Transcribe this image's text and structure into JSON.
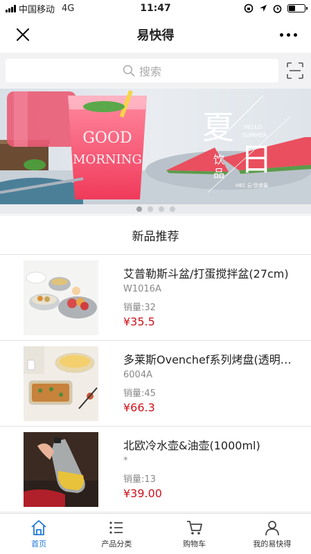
{
  "status_bar": {
    "carrier": "中国移动",
    "network": "4G",
    "time": "11:47"
  },
  "nav": {
    "title": "易快得",
    "close_icon": "close-icon",
    "more_icon": "more-icon"
  },
  "search": {
    "placeholder": "搜索",
    "scan_icon": "scan-icon"
  },
  "banner": {
    "glass_text_1": "GOOD",
    "glass_text_2": "MORNING",
    "big_char_1": "夏",
    "big_char_2": "日",
    "small_char_1": "饮",
    "small_char_2": "品",
    "hello": "HELLO",
    "summer": "SUMMER",
    "footer": "HEC 云·饮食篇",
    "slide_count": 4,
    "active_slide": 1
  },
  "section": {
    "title": "新品推荐"
  },
  "products": [
    {
      "name": "艾普勒斯斗盆/打蛋搅拌盆(27cm)",
      "code": "W1016A",
      "sales": "销量:32",
      "price": "¥35.5"
    },
    {
      "name": "多莱斯Ovenchef系列烤盘(透明…",
      "code": "6004A",
      "sales": "销量:45",
      "price": "¥66.3"
    },
    {
      "name": "北欧冷水壶&油壶(1000ml)",
      "code": "*",
      "sales": "销量:13",
      "price": "¥39.00"
    }
  ],
  "tabs": [
    {
      "label": "首页",
      "icon": "home-icon",
      "active": true
    },
    {
      "label": "产品分类",
      "icon": "list-icon",
      "active": false
    },
    {
      "label": "购物车",
      "icon": "cart-icon",
      "active": false
    },
    {
      "label": "我的易快得",
      "icon": "user-icon",
      "active": false
    }
  ],
  "colors": {
    "accent": "#1f7ad8",
    "price": "#d0121b"
  }
}
